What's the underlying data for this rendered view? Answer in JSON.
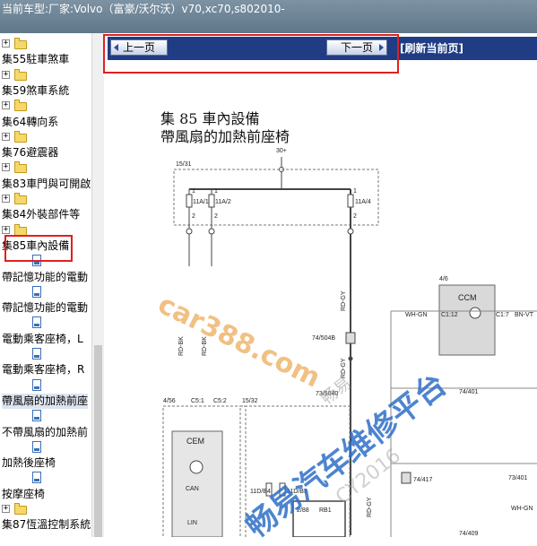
{
  "header": {
    "vehicle_prefix": "当前车型:",
    "vehicle_name": "厂家:Volvo（富豪/沃尔沃）v70,xc70,s802010-"
  },
  "sidebar": {
    "items": [
      {
        "type": "folder",
        "label": ""
      },
      {
        "type": "text",
        "label": "集55駐車煞車"
      },
      {
        "type": "folder",
        "label": ""
      },
      {
        "type": "text",
        "label": "集59煞車系統"
      },
      {
        "type": "folder",
        "label": ""
      },
      {
        "type": "text",
        "label": "集64轉向系"
      },
      {
        "type": "folder",
        "label": ""
      },
      {
        "type": "text",
        "label": "集76避震器"
      },
      {
        "type": "folder",
        "label": ""
      },
      {
        "type": "text",
        "label": "集83車門與可開啟"
      },
      {
        "type": "folder",
        "label": ""
      },
      {
        "type": "text",
        "label": "集84外裝部件等"
      },
      {
        "type": "folder",
        "label": ""
      },
      {
        "type": "text",
        "label": "集85車內設備"
      },
      {
        "type": "doc",
        "label": ""
      },
      {
        "type": "text",
        "label": "帶記憶功能的電動"
      },
      {
        "type": "doc",
        "label": ""
      },
      {
        "type": "text",
        "label": "帶記憶功能的電動"
      },
      {
        "type": "doc",
        "label": ""
      },
      {
        "type": "text",
        "label": "電動乘客座椅，L"
      },
      {
        "type": "doc",
        "label": ""
      },
      {
        "type": "text",
        "label": "電動乘客座椅，R"
      },
      {
        "type": "doc",
        "label": ""
      },
      {
        "type": "text",
        "label": "帶風扇的加熱前座"
      },
      {
        "type": "doc",
        "label": ""
      },
      {
        "type": "text",
        "label": "不帶風扇的加熱前"
      },
      {
        "type": "doc",
        "label": ""
      },
      {
        "type": "text",
        "label": "加熱後座椅"
      },
      {
        "type": "doc",
        "label": ""
      },
      {
        "type": "text",
        "label": "按摩座椅"
      },
      {
        "type": "folder",
        "label": ""
      },
      {
        "type": "text",
        "label": "集87恆溫控制系統"
      }
    ]
  },
  "nav": {
    "prev_label": "上一页",
    "next_label": "下一页",
    "refresh_label": "[刷新当前页]"
  },
  "document": {
    "title_line1": "集 85 車內設備",
    "title_line2": "帶風扇的加熱前座椅"
  },
  "diagram": {
    "labels": {
      "v30": "30+",
      "c1531": "15/31",
      "f1": "11A/1",
      "f2": "11A/2",
      "f4": "11A/4",
      "w1": "RD-BK",
      "w2": "RD-BK",
      "w3": "RD-GY",
      "w4": "RD-GY",
      "w5": "RD-GY",
      "j1": "74/504B",
      "j2": "73/5040",
      "c456": "4/56",
      "c1532": "15/32",
      "c51": "C5:1",
      "c52": "C5:2",
      "cem": "CEM",
      "can": "CAN",
      "lin": "LIN",
      "fb4": "11D/B4",
      "fb3": "11D/B3",
      "m288": "2/88",
      "rb1": "RB1",
      "ccm_ref": "4/6",
      "ccm": "CCM",
      "c112": "C1:12",
      "c17": "C1:7",
      "whgn1": "WH-GN",
      "bnvt": "BN-VT",
      "c74401": "74/401",
      "c74417": "74/417",
      "c73401": "73/401",
      "c74409": "74/409",
      "whgn2": "WH-GN",
      "pin1": "1",
      "pin2": "2"
    }
  },
  "watermarks": {
    "site": "car388.com",
    "platform": "畅易汽车维修平台",
    "small1": "畅易",
    "small2": "CY2016"
  },
  "colors": {
    "topbar": "#6b8396",
    "navbar": "#1f3c84",
    "highlight_box": "#e02020",
    "watermark_blue": "#2f6fc7"
  }
}
